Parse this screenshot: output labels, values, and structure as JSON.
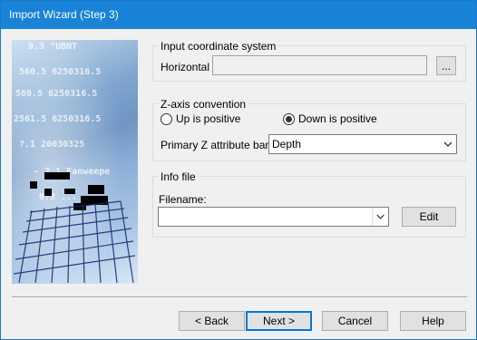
{
  "window": {
    "title": "Import Wizard (Step 3)"
  },
  "banner": {
    "overlay_lines": [
      "9.3 °UBNT",
      "560.5 6250316.5",
      "560.5 6250316.5",
      "2561.5 6250316.5",
      "?.1 20030325",
      "- 2.1 Fanweepe",
      "0.3 ..."
    ]
  },
  "input_coordinate_system": {
    "group_label": "Input coordinate system",
    "horizontal_label": "Horizontal",
    "horizontal_value": "",
    "browse_label": "..."
  },
  "z_axis": {
    "group_label": "Z-axis convention",
    "options": [
      {
        "label": "Up is positive",
        "checked": false
      },
      {
        "label": "Down is positive",
        "checked": true
      }
    ],
    "primary_band_label": "Primary Z attribute band",
    "primary_band_value": "Depth"
  },
  "info_file": {
    "group_label": "Info file",
    "filename_label": "Filename:",
    "filename_value": "",
    "edit_label": "Edit"
  },
  "buttons": {
    "back": "< Back",
    "next": "Next >",
    "cancel": "Cancel",
    "help": "Help"
  }
}
